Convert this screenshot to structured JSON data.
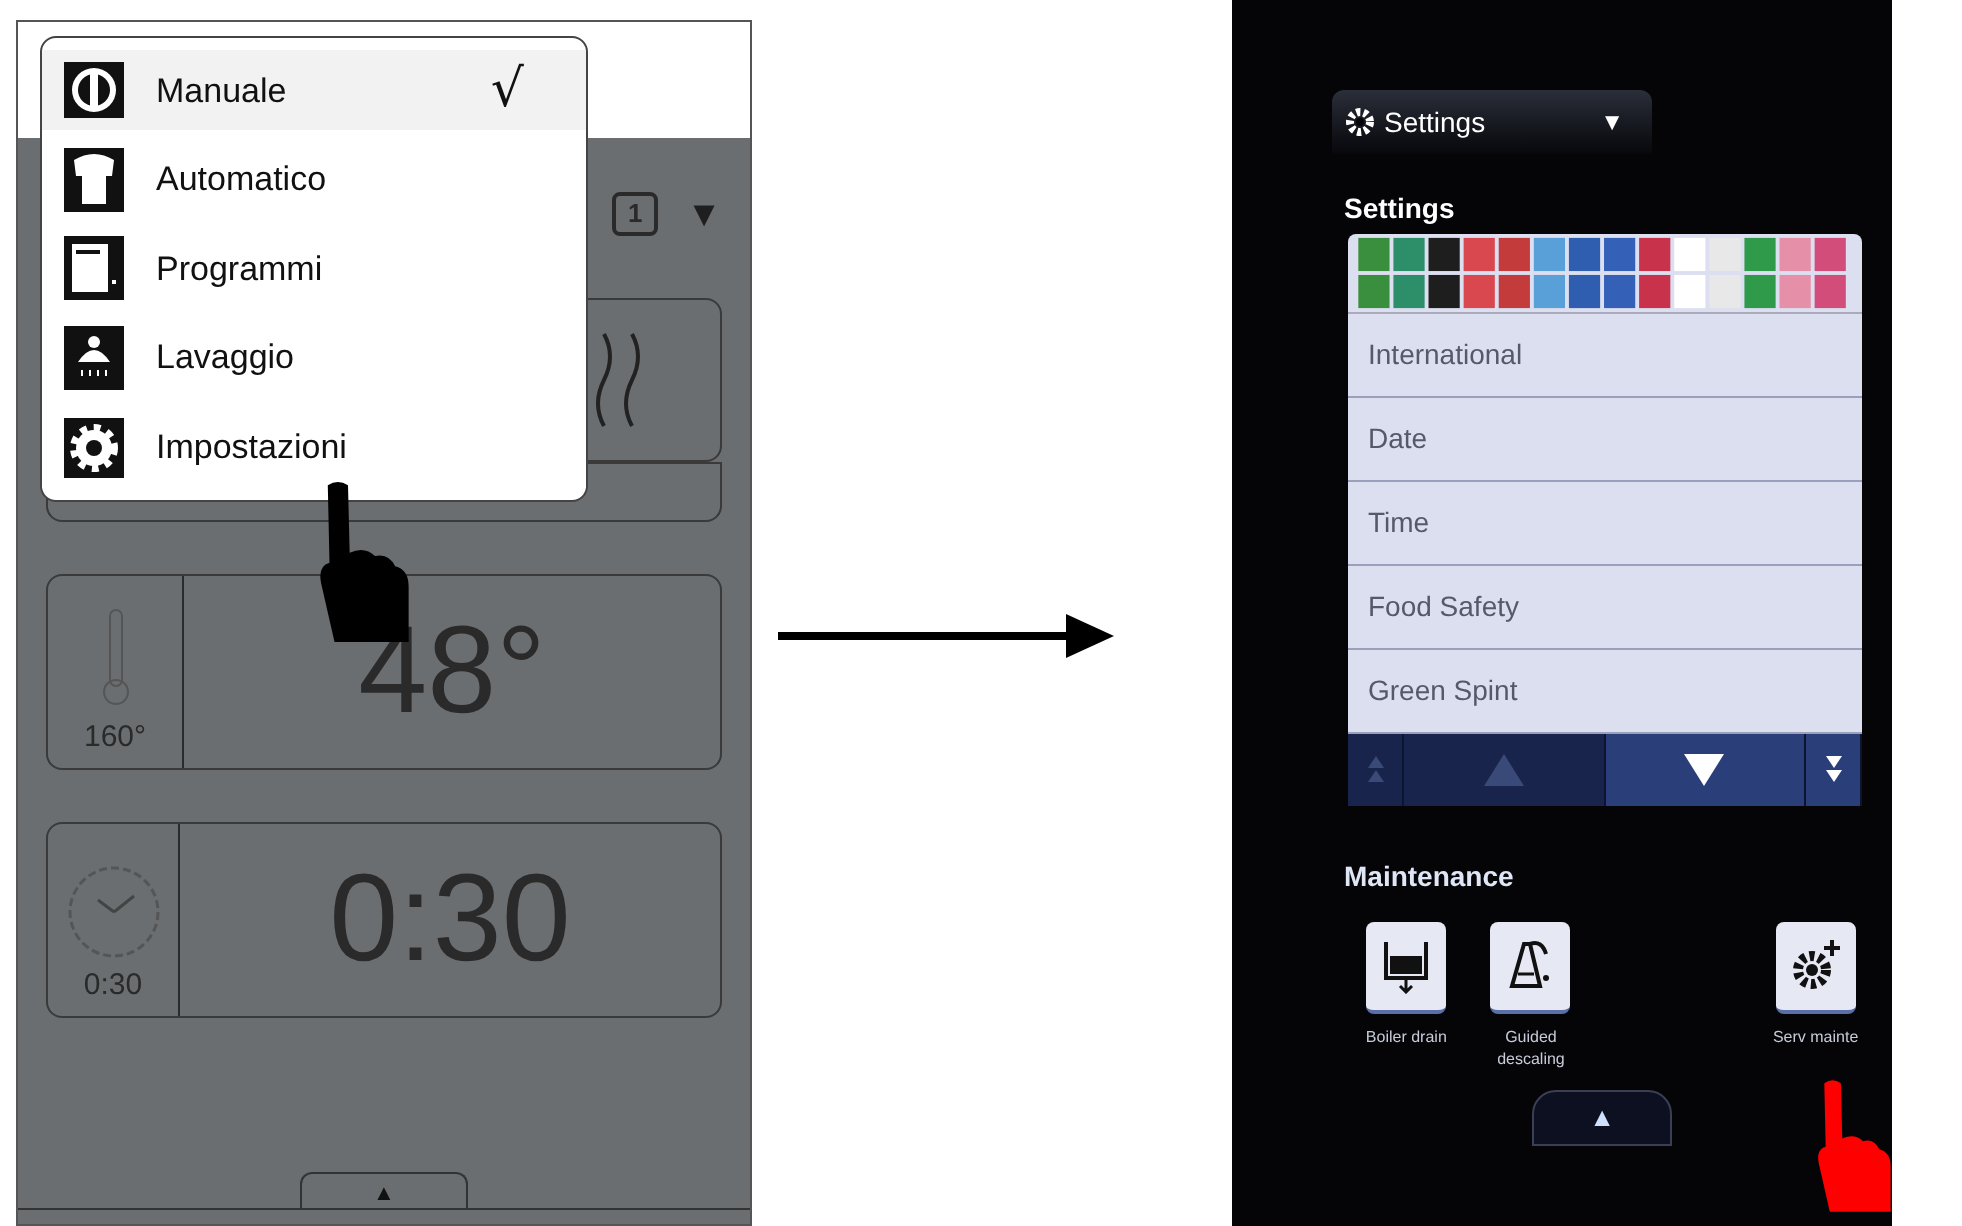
{
  "left_screen": {
    "menu": {
      "check_mark": "√",
      "items": [
        {
          "label": "Manuale",
          "selected": true
        },
        {
          "label": "Automatico",
          "selected": false
        },
        {
          "label": "Programmi",
          "selected": false
        },
        {
          "label": "Lavaggio",
          "selected": false
        },
        {
          "label": "Impostazioni",
          "selected": false
        }
      ]
    },
    "selector": {
      "value": "1",
      "arrow": "▼"
    },
    "temperature": {
      "setpoint": "160°",
      "reading": "48°"
    },
    "timer": {
      "setpoint": "0:30",
      "reading": "0:30"
    },
    "bottom_tab": "▲"
  },
  "right_screen": {
    "header": {
      "title": "Settings",
      "arrow": "▼"
    },
    "section_title": "Settings",
    "list_items": [
      "International",
      "Date",
      "Time",
      "Food Safety",
      "Green Spint"
    ],
    "nav_buttons": [
      {
        "kind": "double-up",
        "disabled": true
      },
      {
        "kind": "up",
        "disabled": true
      },
      {
        "kind": "down",
        "disabled": false
      },
      {
        "kind": "double-down",
        "disabled": false
      }
    ],
    "maintenance": {
      "title": "Maintenance",
      "buttons": [
        {
          "kind": "drain",
          "label": "Boiler drain"
        },
        {
          "kind": "descaling",
          "label": "Guided descaling"
        },
        {
          "kind": "service",
          "label": "Serv mainte"
        }
      ]
    },
    "scroll_button": "▲"
  }
}
